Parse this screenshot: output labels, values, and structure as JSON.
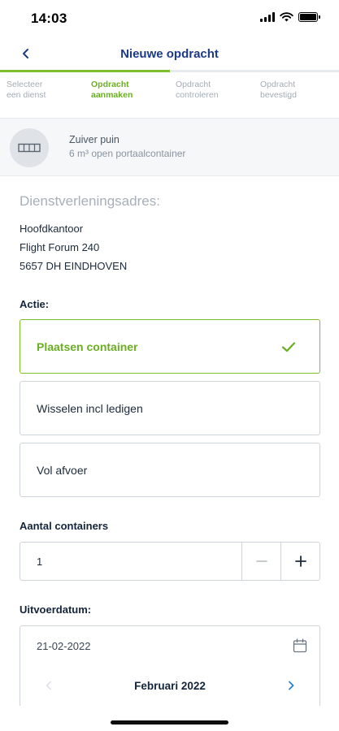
{
  "status_bar": {
    "time": "14:03"
  },
  "nav": {
    "title": "Nieuwe opdracht",
    "back_icon": "chevron-left-icon"
  },
  "progress": {
    "fraction": 0.5,
    "color": "#7cbf2a"
  },
  "steps": [
    {
      "line1": "Selecteer",
      "line2": "een dienst",
      "active": false
    },
    {
      "line1": "Opdracht",
      "line2": "aanmaken",
      "active": true
    },
    {
      "line1": "Opdracht",
      "line2": "controleren",
      "active": false
    },
    {
      "line1": "Opdracht",
      "line2": "bevestigd",
      "active": false
    }
  ],
  "product": {
    "name": "Zuiver puin",
    "description": "6 m³ open portaalcontainer",
    "icon": "container-icon"
  },
  "address": {
    "label": "Dienstverleningsadres:",
    "lines": [
      "Hoofdkantoor",
      "Flight Forum 240",
      "5657 DH EINDHOVEN"
    ]
  },
  "action": {
    "label": "Actie:",
    "options": [
      {
        "label": "Plaatsen container",
        "selected": true
      },
      {
        "label": "Wisselen incl ledigen",
        "selected": false
      },
      {
        "label": "Vol afvoer",
        "selected": false
      }
    ]
  },
  "containers": {
    "label": "Aantal containers",
    "value": "1",
    "decrement_icon": "minus-icon",
    "increment_icon": "plus-icon"
  },
  "execution_date": {
    "label": "Uitvoerdatum:",
    "value": "21-02-2022",
    "calendar_month": "Februari 2022"
  },
  "colors": {
    "brand_blue": "#1b3a87",
    "accent_green": "#7cbf2a",
    "link_blue": "#2a7fc9"
  }
}
